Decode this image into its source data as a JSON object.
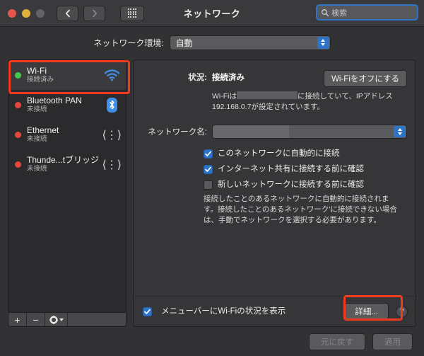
{
  "window": {
    "title": "ネットワーク",
    "traffic_lights": [
      "close",
      "minimize",
      "zoom-disabled"
    ],
    "nav_back_icon": "chevron-left-icon",
    "nav_forward_icon": "chevron-right-icon",
    "grid_icon": "grid-view-icon"
  },
  "search": {
    "placeholder": "検索",
    "icon": "search-icon",
    "focus_color": "#2d74c9"
  },
  "environment": {
    "label": "ネットワーク環境:",
    "value": "自動",
    "options": [
      "自動"
    ]
  },
  "sidebar": {
    "items": [
      {
        "name": "Wi-Fi",
        "status": "接続済み",
        "dot": "green",
        "icon": "wifi-icon",
        "selected": true
      },
      {
        "name": "Bluetooth PAN",
        "status": "未接続",
        "dot": "red",
        "icon": "bluetooth-icon",
        "selected": false
      },
      {
        "name": "Ethernet",
        "status": "未接続",
        "dot": "red",
        "icon": "ethernet-icon",
        "selected": false
      },
      {
        "name": "Thunde...tブリッジ",
        "status": "未接続",
        "dot": "red",
        "icon": "ethernet-icon",
        "selected": false
      }
    ],
    "toolbar": {
      "add_label": "+",
      "remove_label": "−",
      "gear_icon": "gear-icon",
      "gear_chevron_icon": "chevron-down-icon"
    }
  },
  "main": {
    "status_label": "状況:",
    "status_value": "接続済み",
    "toggle_button": "Wi-Fiをオフにする",
    "status_desc_pre": "Wi-Fiは",
    "status_desc_post": "に接続していて、IPアドレス 192.168.0.7が設定されています。",
    "ip_address": "192.168.0.7",
    "network_name_label": "ネットワーク名:",
    "network_name_value": "",
    "checkboxes": [
      {
        "label": "このネットワークに自動的に接続",
        "checked": true
      },
      {
        "label": "インターネット共有に接続する前に確認",
        "checked": true
      },
      {
        "label": "新しいネットワークに接続する前に確認",
        "checked": false
      }
    ],
    "help_text": "接続したことのあるネットワークに自動的に接続されます。接続したことのあるネットワーク'に接続できない場合は、手動でネットワークを選択する必要があります。",
    "menubar_checkbox": {
      "label": "メニューバーにWi-Fiの状況を表示",
      "checked": true
    },
    "details_button": "詳細...",
    "help_button": "?"
  },
  "footer": {
    "revert_button": "元に戻す",
    "apply_button": "適用"
  },
  "annotations": {
    "color": "#f23a1d",
    "boxes": [
      "wifi-sidebar-item",
      "details-button"
    ]
  }
}
